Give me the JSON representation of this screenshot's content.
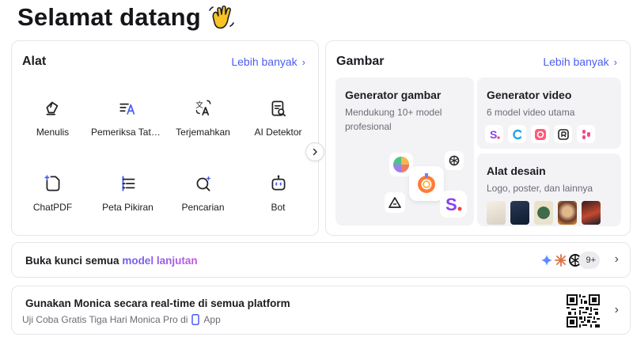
{
  "header": {
    "title": "Selamat datang",
    "emoji_icon": "waving-hand-icon"
  },
  "tools": {
    "title": "Alat",
    "more_label": "Lebih banyak",
    "items": [
      {
        "label": "Menulis",
        "icon": "pen-icon"
      },
      {
        "label": "Pemeriksa Tata Bahasa",
        "icon": "grammar-check-icon"
      },
      {
        "label": "Terjemahkan",
        "icon": "translate-icon"
      },
      {
        "label": "AI Detektor",
        "icon": "ai-detector-icon"
      },
      {
        "label": "ChatPDF",
        "icon": "chatpdf-icon"
      },
      {
        "label": "Peta Pikiran",
        "icon": "mind-map-icon"
      },
      {
        "label": "Pencarian",
        "icon": "search-sparkle-icon"
      },
      {
        "label": "Bot",
        "icon": "bot-icon"
      }
    ]
  },
  "images": {
    "title": "Gambar",
    "more_label": "Lebih banyak",
    "image_generator": {
      "title": "Generator gambar",
      "desc": "Mendukung 10+ model profesional"
    },
    "video_generator": {
      "title": "Generator video",
      "desc": "6 model video utama"
    },
    "design_tools": {
      "title": "Alat desain",
      "desc": "Logo, poster, dan lainnya"
    }
  },
  "unlock": {
    "text_prefix": "Buka kunci semua",
    "text_highlight": "model lanjutan",
    "model_count": "9+"
  },
  "realtime": {
    "title": "Gunakan Monica secara real-time di semua platform",
    "subtitle_prefix": "Uji Coba Gratis Tiga Hari Monica Pro di",
    "subtitle_suffix": "App"
  },
  "colors": {
    "accent": "#4a5ef0",
    "gradient_start": "#6a5cf0",
    "gradient_end": "#c05ce0"
  }
}
